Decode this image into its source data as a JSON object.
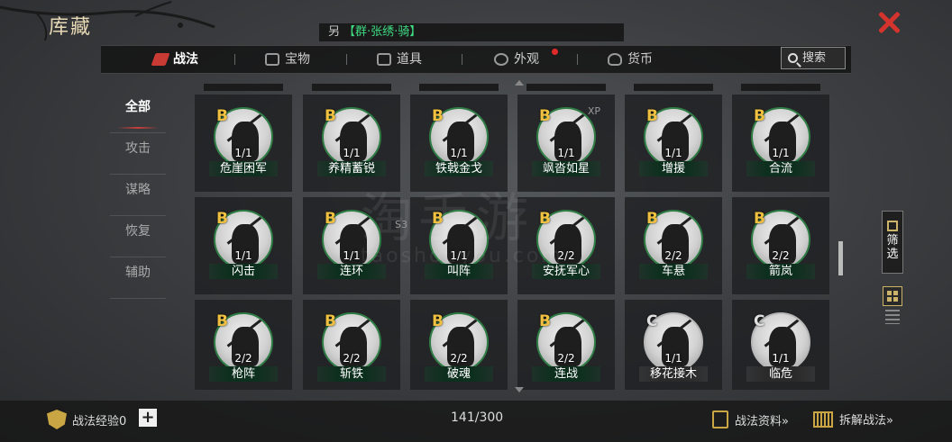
{
  "header": {
    "title": "库藏",
    "hero_symbol": "另",
    "hero_text": "【群·张绣·骑】"
  },
  "tabs": [
    {
      "label": "战法",
      "icon": "scroll-icon",
      "active": true
    },
    {
      "label": "宝物",
      "icon": "treasure-icon"
    },
    {
      "label": "道具",
      "icon": "item-icon"
    },
    {
      "label": "外观",
      "icon": "appearance-icon",
      "notify": true
    },
    {
      "label": "货币",
      "icon": "coin-bag-icon"
    }
  ],
  "search_label": "搜索",
  "sidebar": [
    "全部",
    "攻击",
    "谋略",
    "恢复",
    "辅助"
  ],
  "cards": [
    {
      "grade": "B",
      "count": "1/1",
      "name": "危崖困军"
    },
    {
      "grade": "B",
      "count": "1/1",
      "name": "养精蓄锐"
    },
    {
      "grade": "B",
      "count": "1/1",
      "name": "铁戟金戈"
    },
    {
      "grade": "B",
      "count": "1/1",
      "name": "飒沓如星",
      "badge": "XP"
    },
    {
      "grade": "B",
      "count": "1/1",
      "name": "增援"
    },
    {
      "grade": "B",
      "count": "1/1",
      "name": "合流"
    },
    {
      "grade": "B",
      "count": "1/1",
      "name": "闪击"
    },
    {
      "grade": "B",
      "count": "1/1",
      "name": "连环",
      "badge": "S3"
    },
    {
      "grade": "B",
      "count": "1/1",
      "name": "叫阵"
    },
    {
      "grade": "B",
      "count": "2/2",
      "name": "安抚军心"
    },
    {
      "grade": "B",
      "count": "2/2",
      "name": "车悬"
    },
    {
      "grade": "B",
      "count": "2/2",
      "name": "箭岚"
    },
    {
      "grade": "B",
      "count": "2/2",
      "name": "枪阵"
    },
    {
      "grade": "B",
      "count": "2/2",
      "name": "斩铁"
    },
    {
      "grade": "B",
      "count": "2/2",
      "name": "破魂"
    },
    {
      "grade": "B",
      "count": "2/2",
      "name": "连战"
    },
    {
      "grade": "C",
      "count": "1/1",
      "name": "移花接木"
    },
    {
      "grade": "C",
      "count": "1/1",
      "name": "临危"
    }
  ],
  "filter_label": "筛选",
  "watermark": {
    "main": "淘手游",
    "sub": "taoshouyou.com"
  },
  "footer": {
    "exp_label": "战法经验0",
    "plus": "+",
    "capacity": "141/300",
    "info_link": "战法资料»",
    "dismantle_link": "拆解战法»"
  },
  "colors": {
    "accent_red": "#d5332d",
    "grade_b": "#f0c040",
    "name_bar_green": "#0d2f1e",
    "hero_green": "#3fdc82"
  }
}
